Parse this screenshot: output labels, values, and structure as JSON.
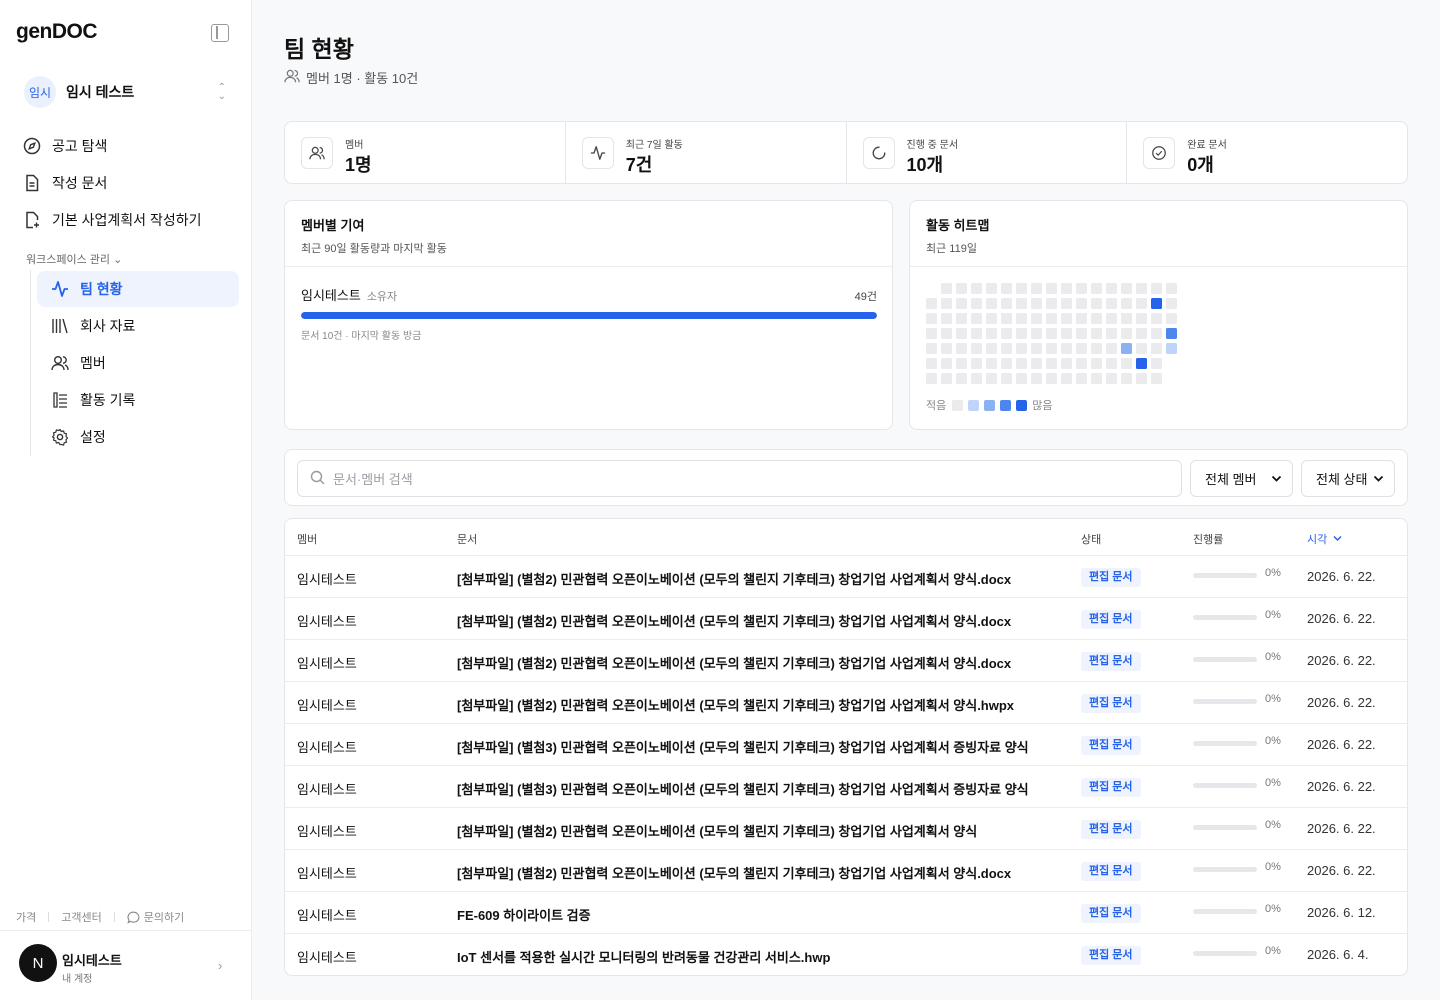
{
  "sidebar": {
    "logo_light": "gen",
    "logo_bold": "DOC",
    "workspace": {
      "badge": "임시",
      "name": "임시 테스트"
    },
    "nav": [
      {
        "label": "공고 탐색",
        "icon": "compass-icon"
      },
      {
        "label": "작성 문서",
        "icon": "document-icon"
      },
      {
        "label": "기본 사업계획서 작성하기",
        "icon": "document-add-icon"
      }
    ],
    "section_label": "워크스페이스 관리",
    "sub": [
      {
        "label": "팀 현황",
        "icon": "activity-icon",
        "active": true
      },
      {
        "label": "회사 자료",
        "icon": "library-icon"
      },
      {
        "label": "멤버",
        "icon": "users-icon"
      },
      {
        "label": "활동 기록",
        "icon": "log-icon"
      },
      {
        "label": "설정",
        "icon": "gear-icon"
      }
    ],
    "footer": {
      "price": "가격",
      "support": "고객센터",
      "inquiry": "문의하기"
    },
    "profile": {
      "initial": "N",
      "name": "임시테스트",
      "sub": "내 계정"
    }
  },
  "header": {
    "title": "팀 현황",
    "subtitle": "멤버 1명 · 활동 10건"
  },
  "stats": [
    {
      "label": "멤버",
      "value": "1명",
      "icon": "users-icon"
    },
    {
      "label": "최근 7일 활동",
      "value": "7건",
      "icon": "activity-icon"
    },
    {
      "label": "진행 중 문서",
      "value": "10개",
      "icon": "loading-icon"
    },
    {
      "label": "완료 문서",
      "value": "0개",
      "icon": "check-circle-icon"
    }
  ],
  "contribution": {
    "title": "멤버별 기여",
    "subtitle": "최근 90일 활동량과 마지막 활동",
    "member": {
      "name": "임시테스트",
      "role": "소유자",
      "count": "49건",
      "share": 1.0,
      "meta": "문서 10건 · 마지막 활동 방금"
    }
  },
  "heatmap": {
    "title": "활동 히트맵",
    "subtitle": "최근 119일",
    "legend_low": "적음",
    "legend_high": "많음",
    "levels_colors": [
      "#ebebee",
      "#bfd3fb",
      "#8bb1f5",
      "#4d86ee",
      "#2563eb"
    ],
    "columns": [
      [
        null,
        0,
        0,
        0,
        0,
        0,
        0
      ],
      [
        0,
        0,
        0,
        0,
        0,
        0,
        0
      ],
      [
        0,
        0,
        0,
        0,
        0,
        0,
        0
      ],
      [
        0,
        0,
        0,
        0,
        0,
        0,
        0
      ],
      [
        0,
        0,
        0,
        0,
        0,
        0,
        0
      ],
      [
        0,
        0,
        0,
        0,
        0,
        0,
        0
      ],
      [
        0,
        0,
        0,
        0,
        0,
        0,
        0
      ],
      [
        0,
        0,
        0,
        0,
        0,
        0,
        0
      ],
      [
        0,
        0,
        0,
        0,
        0,
        0,
        0
      ],
      [
        0,
        0,
        0,
        0,
        0,
        0,
        0
      ],
      [
        0,
        0,
        0,
        0,
        0,
        0,
        0
      ],
      [
        0,
        0,
        0,
        0,
        0,
        0,
        0
      ],
      [
        0,
        0,
        0,
        0,
        0,
        0,
        0
      ],
      [
        0,
        0,
        0,
        0,
        2,
        0,
        0
      ],
      [
        0,
        0,
        0,
        0,
        0,
        4,
        0
      ],
      [
        0,
        4,
        0,
        0,
        0,
        0,
        0
      ],
      [
        0,
        0,
        0,
        3,
        1,
        null,
        null
      ]
    ]
  },
  "filters": {
    "search_placeholder": "문서·멤버 검색",
    "member_select": "전체 멤버",
    "status_select": "전체 상태"
  },
  "table": {
    "headers": {
      "member": "멤버",
      "doc": "문서",
      "status": "상태",
      "progress": "진행률",
      "time": "시각"
    },
    "rows": [
      {
        "member": "임시테스트",
        "doc": "[첨부파일] (별첨2) 민관협력 오픈이노베이션 (모두의 챌린지 기후테크) 창업기업 사업계획서 양식.docx",
        "status": "편집 문서",
        "progress": "0%",
        "date": "2026. 6. 22."
      },
      {
        "member": "임시테스트",
        "doc": "[첨부파일] (별첨2) 민관협력 오픈이노베이션 (모두의 챌린지 기후테크) 창업기업 사업계획서 양식.docx",
        "status": "편집 문서",
        "progress": "0%",
        "date": "2026. 6. 22."
      },
      {
        "member": "임시테스트",
        "doc": "[첨부파일] (별첨2) 민관협력 오픈이노베이션 (모두의 챌린지 기후테크) 창업기업 사업계획서 양식.docx",
        "status": "편집 문서",
        "progress": "0%",
        "date": "2026. 6. 22."
      },
      {
        "member": "임시테스트",
        "doc": "[첨부파일] (별첨2) 민관협력 오픈이노베이션 (모두의 챌린지 기후테크) 창업기업 사업계획서 양식.hwpx",
        "status": "편집 문서",
        "progress": "0%",
        "date": "2026. 6. 22."
      },
      {
        "member": "임시테스트",
        "doc": "[첨부파일] (별첨3) 민관협력 오픈이노베이션 (모두의 챌린지 기후테크) 창업기업 사업계획서 증빙자료 양식",
        "status": "편집 문서",
        "progress": "0%",
        "date": "2026. 6. 22."
      },
      {
        "member": "임시테스트",
        "doc": "[첨부파일] (별첨3) 민관협력 오픈이노베이션 (모두의 챌린지 기후테크) 창업기업 사업계획서 증빙자료 양식",
        "status": "편집 문서",
        "progress": "0%",
        "date": "2026. 6. 22."
      },
      {
        "member": "임시테스트",
        "doc": "[첨부파일] (별첨2) 민관협력 오픈이노베이션 (모두의 챌린지 기후테크) 창업기업 사업계획서 양식",
        "status": "편집 문서",
        "progress": "0%",
        "date": "2026. 6. 22."
      },
      {
        "member": "임시테스트",
        "doc": "[첨부파일] (별첨2) 민관협력 오픈이노베이션 (모두의 챌린지 기후테크) 창업기업 사업계획서 양식.docx",
        "status": "편집 문서",
        "progress": "0%",
        "date": "2026. 6. 22."
      },
      {
        "member": "임시테스트",
        "doc": "FE-609 하이라이트 검증",
        "status": "편집 문서",
        "progress": "0%",
        "date": "2026. 6. 12."
      },
      {
        "member": "임시테스트",
        "doc": "IoT 센서를 적용한 실시간 모니터링의 반려동물 건강관리 서비스.hwp",
        "status": "편집 문서",
        "progress": "0%",
        "date": "2026. 6. 4."
      }
    ]
  },
  "colors": {
    "accent": "#2563eb"
  }
}
